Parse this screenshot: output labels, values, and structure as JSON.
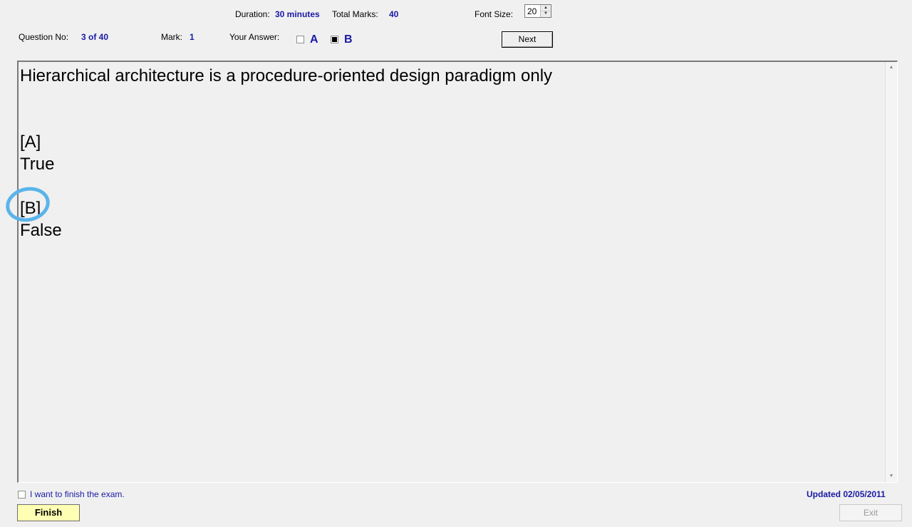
{
  "header": {
    "duration_label": "Duration:",
    "duration_value": "30 minutes",
    "total_marks_label": "Total Marks:",
    "total_marks_value": "40",
    "font_size_label": "Font Size:",
    "font_size_value": "20",
    "question_no_label": "Question No:",
    "question_no_value": "3 of 40",
    "mark_label": "Mark:",
    "mark_value": "1",
    "your_answer_label": "Your Answer:",
    "answer_options": [
      {
        "letter": "A",
        "checked": false
      },
      {
        "letter": "B",
        "checked": true
      }
    ],
    "next_label": "Next"
  },
  "question": {
    "text": "Hierarchical architecture is a procedure-oriented design paradigm only",
    "options": [
      {
        "tag": "[A]",
        "text": "True"
      },
      {
        "tag": "[B]",
        "text": "False"
      }
    ]
  },
  "footer": {
    "finish_checkbox_label": "I want to finish the exam.",
    "finish_checked": false,
    "updated_text": "Updated 02/05/2011",
    "finish_label": "Finish",
    "exit_label": "Exit"
  },
  "colors": {
    "value_blue": "#1a1aa6",
    "finish_button": "#ffffb4",
    "annotation_circle": "#5ab4ea"
  },
  "icons": {
    "spinner_up": "triangle-up-icon",
    "spinner_down": "triangle-down-icon",
    "scroll_up": "scroll-up-arrow-icon",
    "scroll_down": "scroll-down-arrow-icon"
  }
}
